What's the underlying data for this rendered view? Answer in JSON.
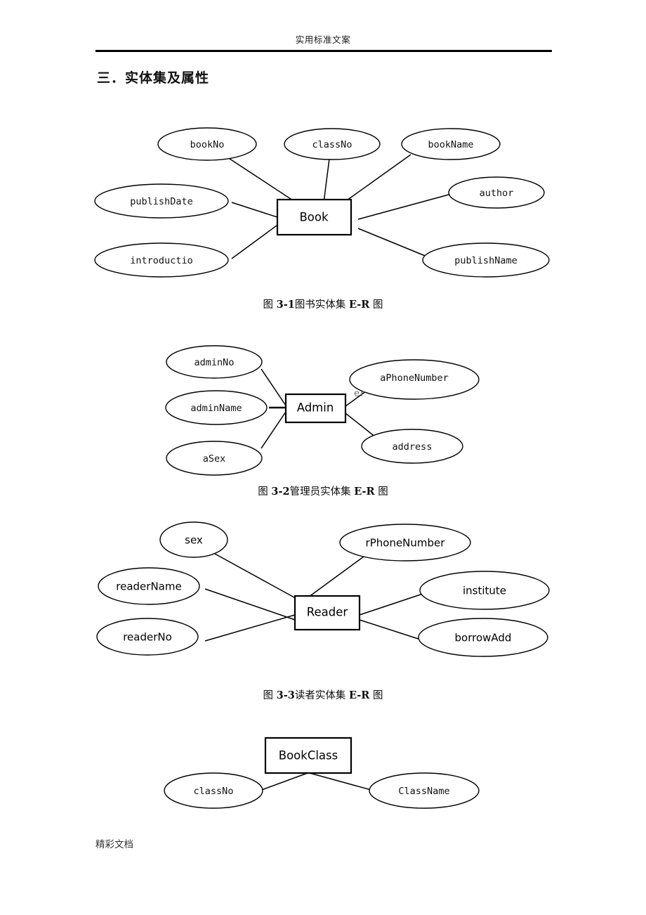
{
  "page": {
    "header_text": "实用标准文案",
    "footer_text": "精彩文档",
    "section_heading": "三．实体集及属性"
  },
  "figures": [
    {
      "id": "fig-3-1",
      "entity": "Book",
      "caption_prefix": "图 ",
      "caption_number": "3-1",
      "caption_body": "图书实体集 ",
      "caption_er": "E-R",
      "caption_suffix": " 图",
      "attributes": [
        "bookNo",
        "classNo",
        "bookName",
        "publishDate",
        "author",
        "introductio",
        "publishName"
      ]
    },
    {
      "id": "fig-3-2",
      "entity": "Admin",
      "caption_prefix": "图 ",
      "caption_number": "3-2",
      "caption_body": "管理员实体集 ",
      "caption_er": "E-R",
      "caption_suffix": " 图",
      "attributes": [
        "adminNo",
        "adminName",
        "aSex",
        "aPhoneNumber",
        "address"
      ],
      "overflow_text": "er"
    },
    {
      "id": "fig-3-3",
      "entity": "Reader",
      "caption_prefix": "图 ",
      "caption_number": "3-3",
      "caption_body": "读者实体集 ",
      "caption_er": "E-R",
      "caption_suffix": " 图",
      "attributes": [
        "sex",
        "rPhoneNumber",
        "readerName",
        "institute",
        "readerNo",
        "borrowAdd"
      ]
    },
    {
      "id": "fig-3-4",
      "entity": "BookClass",
      "attributes": [
        "classNo",
        "ClassName"
      ]
    }
  ]
}
